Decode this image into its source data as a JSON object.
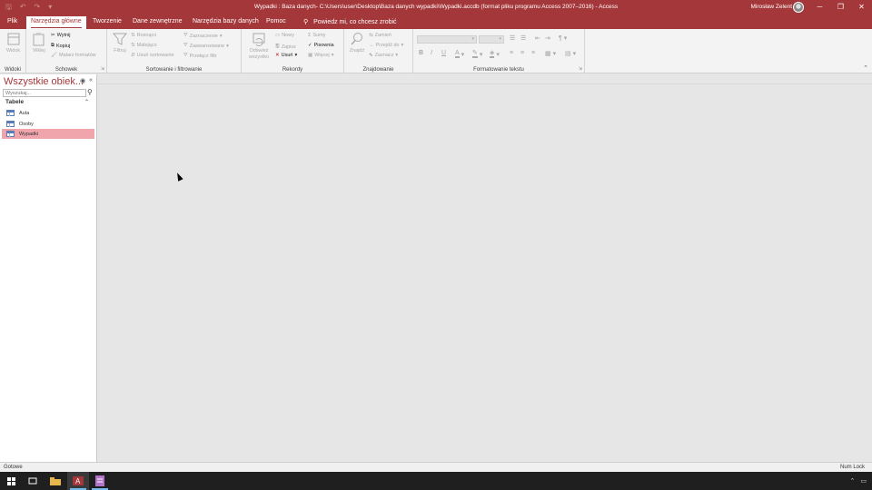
{
  "titlebar": {
    "title": "Wypadki : Baza danych- C:\\Users\\user\\Desktop\\Baza danych wypadki\\Wypadki.accdb (format pliku programu Access 2007–2016)  -  Access",
    "user": "Mirosław Zelent",
    "qat_save": "🖫",
    "qat_undo": "↶",
    "qat_redo": "↷",
    "qat_more": "▾",
    "min": "─",
    "restore": "❐",
    "close": "✕"
  },
  "tabs": [
    {
      "label": "Plik"
    },
    {
      "label": "Narzędzia główne"
    },
    {
      "label": "Tworzenie"
    },
    {
      "label": "Dane zewnętrzne"
    },
    {
      "label": "Narzędzia bazy danych"
    },
    {
      "label": "Pomoc"
    }
  ],
  "tellme": {
    "icon": "⚲",
    "text": "Powiedz mi, co chcesz zrobić"
  },
  "ribbon": {
    "views": {
      "label": "Widoki",
      "btn": "Widok"
    },
    "clipboard": {
      "label": "Schowek",
      "paste": "Wklej",
      "cut": "Wytnij",
      "copy": "Kopiuj",
      "format": "Malarz formatów"
    },
    "sort": {
      "label": "Sortowanie i filtrowanie",
      "filter": "Filtruj",
      "asc": "Rosnąco",
      "desc": "Malejąco",
      "remove": "Usuń sortowanie",
      "selection": "Zaznaczenie",
      "advanced": "Zaawansowane",
      "toggle": "Przełącz filtr"
    },
    "records": {
      "label": "Rekordy",
      "refresh": "Odśwież wszystko",
      "new": "Nowy",
      "save": "Zapisz",
      "delete": "Usuń",
      "totals": "Sumy",
      "spelling": "Pisownia",
      "more": "Więcej"
    },
    "find": {
      "label": "Znajdowanie",
      "find": "Znajdź",
      "replace": "Zamień",
      "goto": "Przejdź do",
      "select": "Zaznacz"
    },
    "text": {
      "label": "Formatowanie tekstu",
      "bold": "B",
      "italic": "I",
      "underline": "U"
    }
  },
  "nav": {
    "title": "Wszystkie obiek...",
    "search_placeholder": "Wyszukaj...",
    "category": "Tabele",
    "items": [
      {
        "label": "Auta"
      },
      {
        "label": "Osoby"
      },
      {
        "label": "Wypadki"
      }
    ]
  },
  "status": {
    "left": "Gotowe",
    "right": "Num Lock"
  },
  "colors": {
    "accent": "#a4373a",
    "selection": "#f0a5ad"
  }
}
